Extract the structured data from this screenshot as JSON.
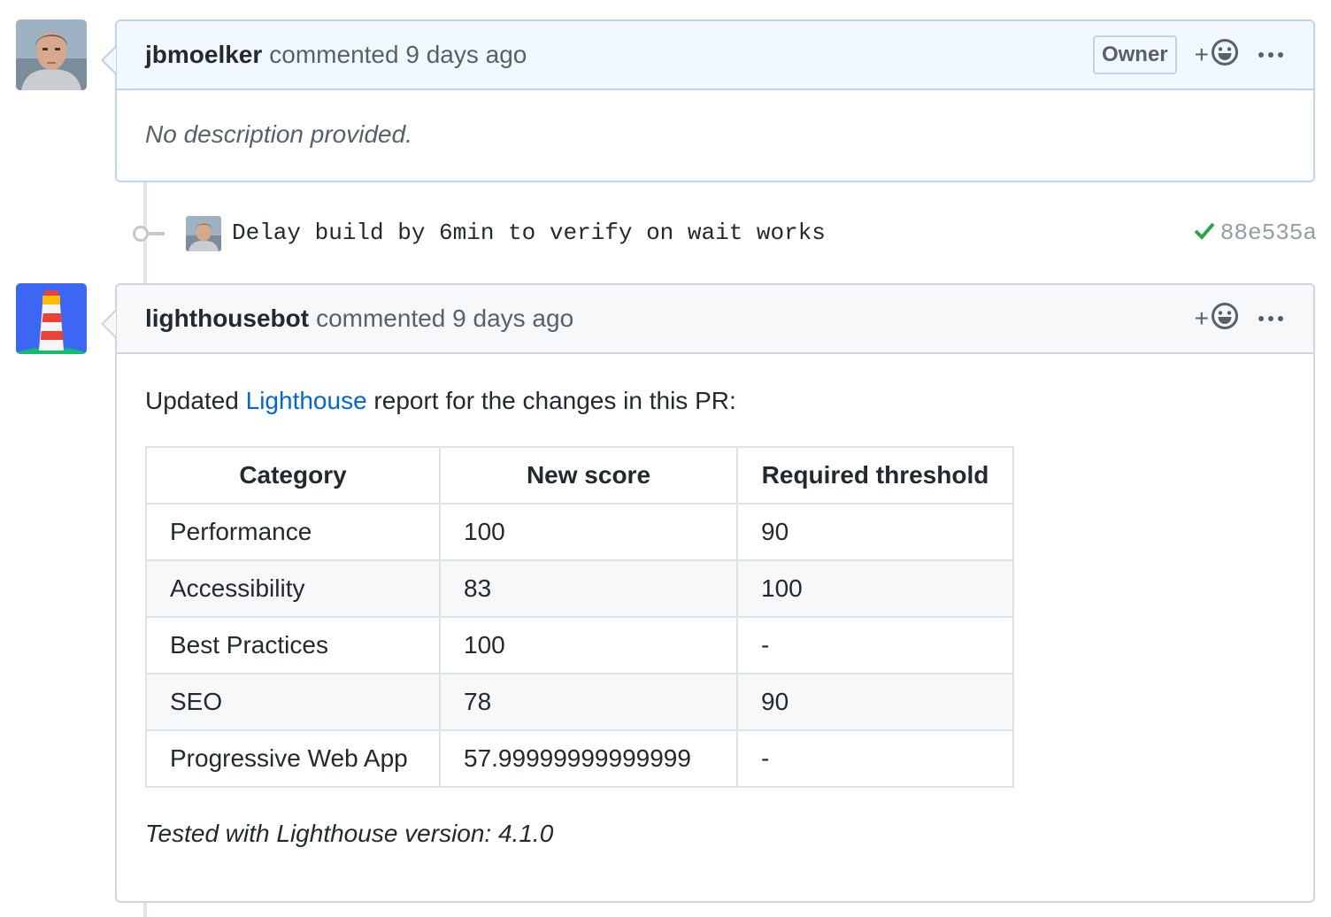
{
  "comments": [
    {
      "author": "jbmoelker",
      "action": "commented 9 days ago",
      "badge": "Owner",
      "body": "No description provided."
    },
    {
      "author": "lighthousebot",
      "action": "commented 9 days ago",
      "intro_prefix": "Updated ",
      "intro_link": "Lighthouse",
      "intro_suffix": " report for the changes in this PR:",
      "table": {
        "headers": [
          "Category",
          "New score",
          "Required threshold"
        ],
        "rows": [
          [
            "Performance",
            "100",
            "90"
          ],
          [
            "Accessibility",
            "83",
            "100"
          ],
          [
            "Best Practices",
            "100",
            "-"
          ],
          [
            "SEO",
            "78",
            "90"
          ],
          [
            "Progressive Web App",
            "57.99999999999999",
            "-"
          ]
        ]
      },
      "footer": "Tested with Lighthouse version: 4.1.0"
    }
  ],
  "commit": {
    "message": "Delay build by 6min to verify on wait works",
    "sha": "88e535a",
    "status": "success"
  },
  "reaction_plus": "+",
  "colors": {
    "link": "#0366d6",
    "success": "#28a745",
    "owner_header": "#f1f8ff",
    "bot_avatar_bg": "#3b67f4"
  }
}
